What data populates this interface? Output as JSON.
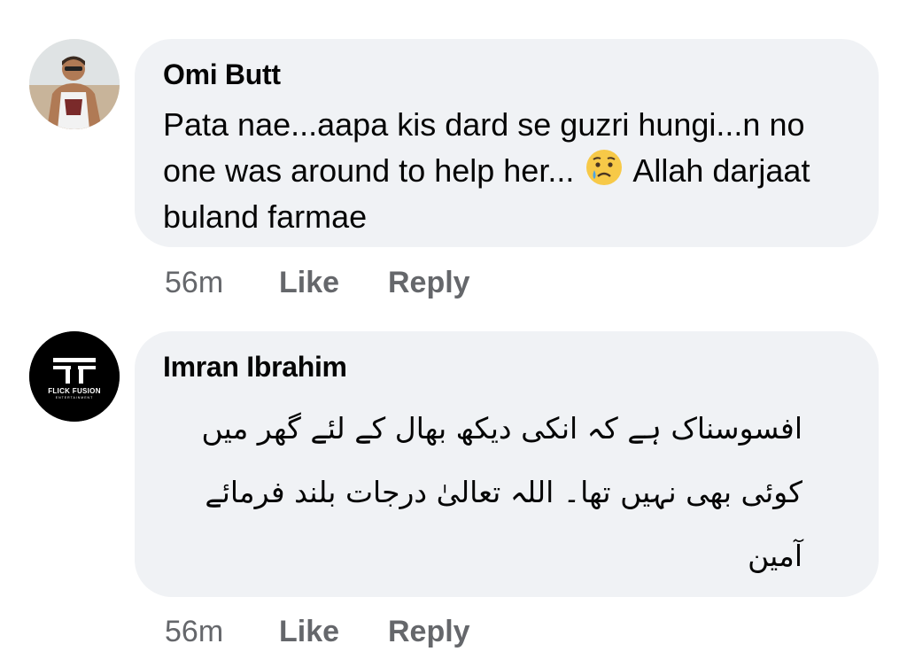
{
  "comments": [
    {
      "author": "Omi Butt",
      "text_before_emoji": "Pata nae...aapa kis dard se guzri hungi...n no one was around to help her...",
      "emoji": "crying-face",
      "text_after_emoji": "Allah darjaat buland farmae",
      "time": "56m",
      "like_label": "Like",
      "reply_label": "Reply"
    },
    {
      "author": "Imran Ibrahim",
      "avatar_logo_text": "FLICK FUSION",
      "avatar_logo_subtext": "ENTERTAINMENT",
      "text": "افسوسناک ہے کہ انکی دیکھ بھال کے لئے گھر میں کوئی بھی نہیں تھا۔ اللہ تعالیٰ درجات بلند فرمائے آمین",
      "time": "56m",
      "like_label": "Like",
      "reply_label": "Reply"
    }
  ]
}
